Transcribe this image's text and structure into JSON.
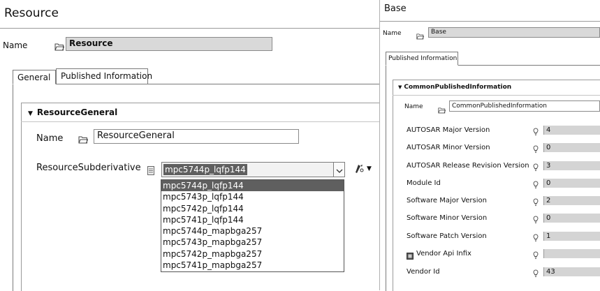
{
  "left_panel": {
    "title": "Resource",
    "name_label": "Name",
    "name_value": "Resource",
    "tabs": [
      {
        "label": "General"
      },
      {
        "label": "Published Information"
      }
    ],
    "section": {
      "title": "ResourceGeneral",
      "name_label": "Name",
      "name_value": "ResourceGeneral",
      "subderivative_label": "ResourceSubderivative",
      "subderivative_value": "mpc5744p_lqfp144",
      "options": [
        "mpc5744p_lqfp144",
        "mpc5743p_lqfp144",
        "mpc5742p_lqfp144",
        "mpc5741p_lqfp144",
        "mpc5744p_mapbga257",
        "mpc5743p_mapbga257",
        "mpc5742p_mapbga257",
        "mpc5741p_mapbga257"
      ]
    }
  },
  "right_panel": {
    "title": "Base",
    "name_label": "Name",
    "name_value": "Base",
    "tab": "Published Information",
    "section": {
      "title": "CommonPublishedInformation",
      "name_label": "Name",
      "name_value": "CommonPublishedInformation",
      "properties": [
        {
          "label": "AUTOSAR Major Version",
          "value": "4"
        },
        {
          "label": "AUTOSAR Minor Version",
          "value": "0"
        },
        {
          "label": "AUTOSAR Release Revision Version",
          "value": "3"
        },
        {
          "label": "Module Id",
          "value": "0"
        },
        {
          "label": "Software Major Version",
          "value": "2"
        },
        {
          "label": "Software Minor Version",
          "value": "0"
        },
        {
          "label": "Software Patch Version",
          "value": "1"
        },
        {
          "label": "Vendor Api Infix",
          "value": ""
        },
        {
          "label": "Vendor Id",
          "value": "43"
        }
      ]
    }
  }
}
